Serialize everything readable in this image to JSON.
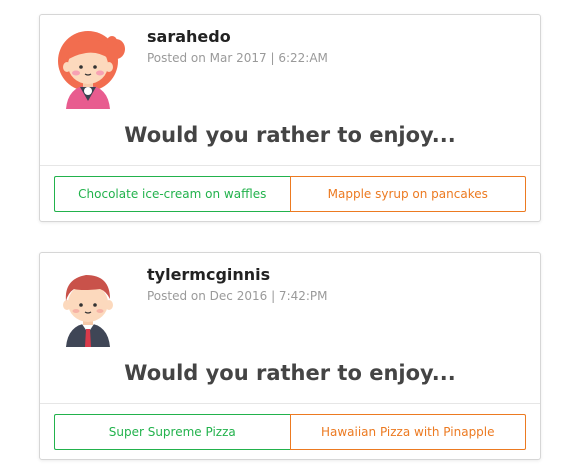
{
  "colors": {
    "option_a": "#22b24c",
    "option_b": "#ec7a21",
    "question_text": "#444444",
    "meta_text": "#9a9a9a"
  },
  "polls": [
    {
      "avatar_icon": "girl-avatar-icon",
      "username": "sarahedo",
      "posted": "Posted on Mar 2017 | 6:22:AM",
      "question": "Would you rather to enjoy...",
      "option_a": "Chocolate ice-cream on waffles",
      "option_b": "Mapple syrup on pancakes"
    },
    {
      "avatar_icon": "boy-avatar-icon",
      "username": "tylermcginnis",
      "posted": "Posted on Dec 2016 | 7:42:PM",
      "question": "Would you rather to enjoy...",
      "option_a": "Super Supreme Pizza",
      "option_b": "Hawaiian Pizza with Pinapple"
    }
  ]
}
